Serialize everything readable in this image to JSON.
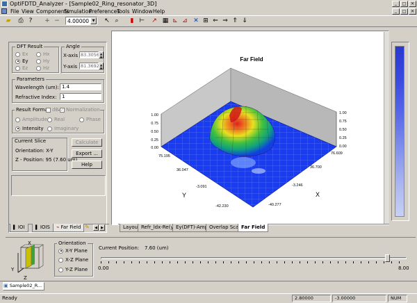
{
  "window": {
    "title": "OptiFDTD_Analyzer - [Sample02_Ring_resonator_3D]"
  },
  "menu": [
    "File",
    "View",
    "Components",
    "Simulation",
    "Preferences",
    "Tools",
    "Window",
    "Help"
  ],
  "toolbar": {
    "zoom_value": "4.00000"
  },
  "dft": {
    "title": "DFT Result",
    "options": [
      [
        "Ex",
        "Hx"
      ],
      [
        "Ey",
        "Hy"
      ],
      [
        "Ez",
        "Hz"
      ]
    ],
    "selected": "Ey"
  },
  "angle": {
    "title": "Angle",
    "x_label": "X-axis",
    "x_value": "83.3056",
    "y_label": "Y-axis",
    "y_value": "81.3692"
  },
  "params": {
    "title": "Parameters",
    "wavelength_label": "Wavelength (um):",
    "wavelength_value": "1.4",
    "index_label": "Refractive Index:",
    "index_value": "1"
  },
  "format": {
    "title": "Result Format",
    "db_label": "dB",
    "norm_label": "Normalization",
    "amplitude": "Amplitude",
    "real": "Real",
    "phase": "Phase",
    "intensity": "Intensity",
    "imaginary": "Imaginary"
  },
  "slice": {
    "title": "Current Slice",
    "orientation": "Orientation:  X-Y",
    "z_position": "Z - Position: 95 (7.60 um)"
  },
  "buttons": {
    "calculate": "Calculate",
    "export": "Export ...",
    "help": "Help"
  },
  "left_tabs": [
    "IOI",
    "IOIS",
    "Far Field"
  ],
  "chart_data": {
    "type": "surface-3d",
    "title": "Far Field",
    "z_ticks": [
      "1.00",
      "0.75",
      "0.50",
      "0.25",
      "0.00"
    ],
    "y_ticks": [
      "75.195",
      "36.047",
      "-3.091",
      "-42.230"
    ],
    "x_ticks": [
      "76.609",
      "36.700",
      "-3.246",
      "-40.277"
    ],
    "xlabel": "X",
    "ylabel": "Y"
  },
  "view_tabs": [
    "Layout",
    "Refr_ldx-Re(y)",
    "Ey(DFT)-Amp",
    "Overlap Scan",
    "Far Field"
  ],
  "orientation": {
    "title": "Orientation",
    "options": [
      "X-Y Plane",
      "X-Z Plane",
      "Y-Z Plane"
    ],
    "selected": "X-Y Plane"
  },
  "axes": {
    "x": "X",
    "y": "Y",
    "z": "Z"
  },
  "position": {
    "label": "Current Position:",
    "value": "7.60 (um)",
    "min": "0.00",
    "max": "8.00"
  },
  "taskbar": {
    "item": "Sample02_R..."
  },
  "status": {
    "ready": "Ready",
    "coord1": "2.80000",
    "coord2": "-3.00000",
    "num": "NUM"
  }
}
